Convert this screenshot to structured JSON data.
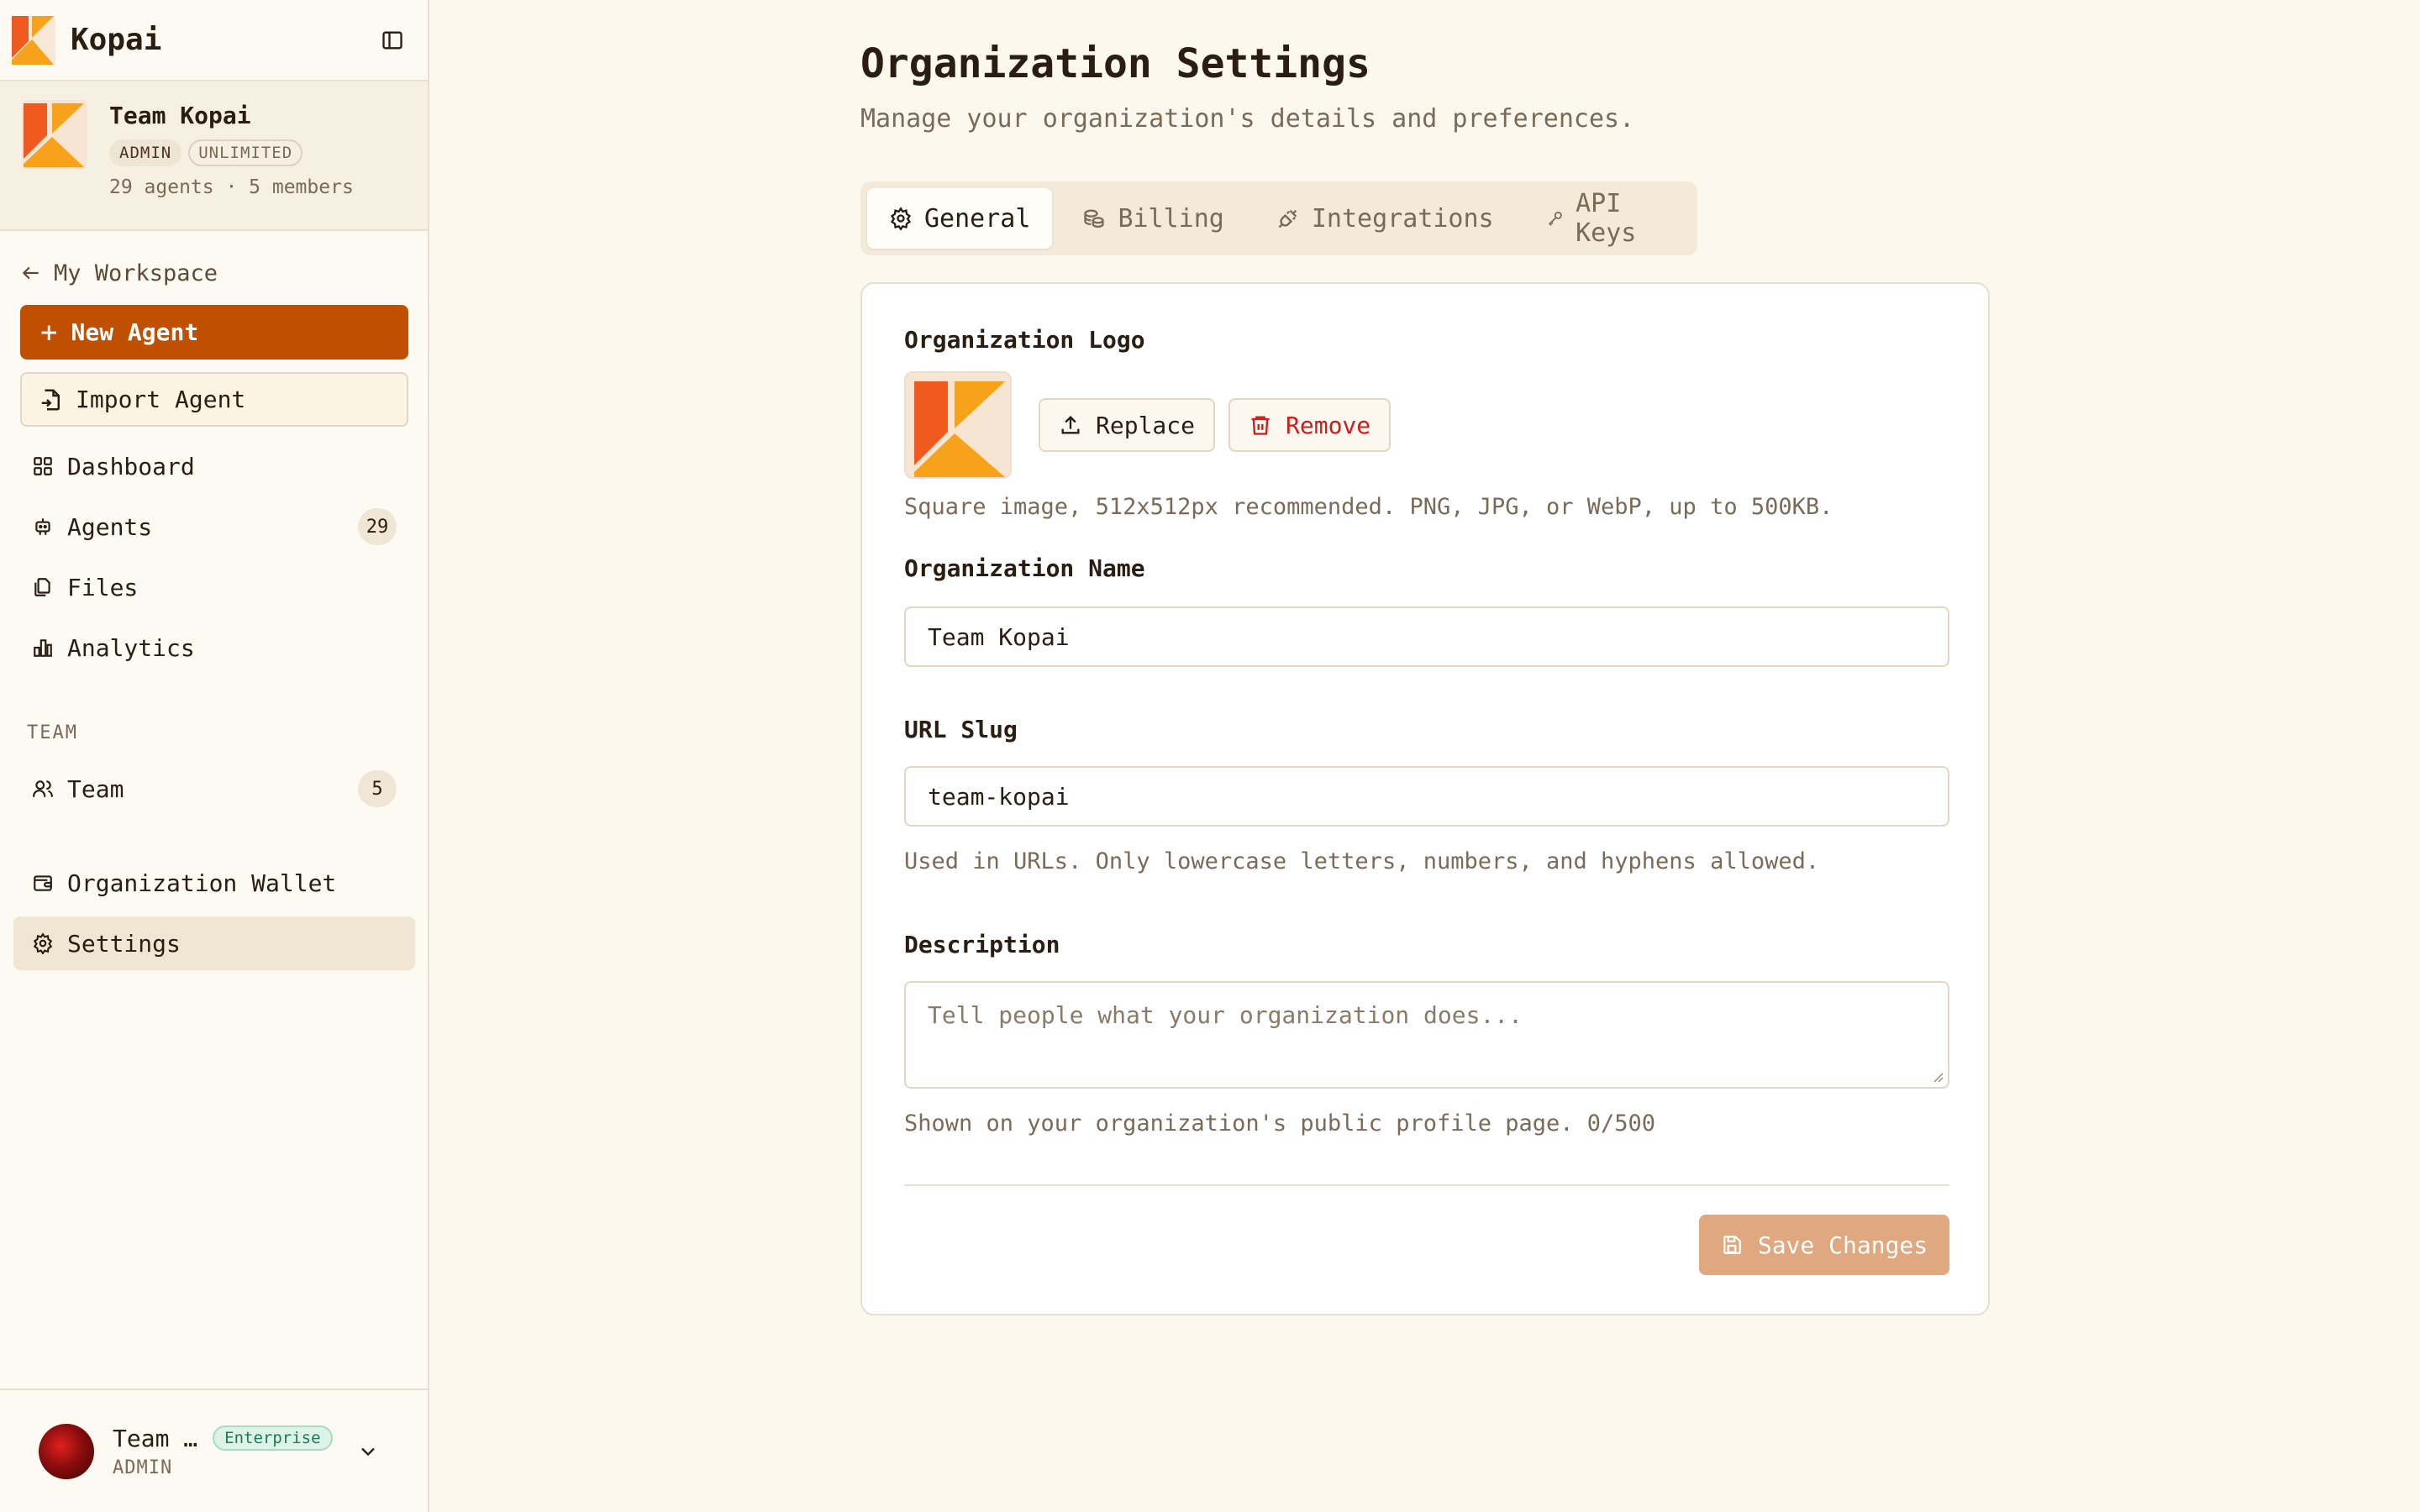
{
  "app": {
    "name": "Kopai"
  },
  "org": {
    "name": "Team Kopai",
    "badges": [
      "ADMIN",
      "UNLIMITED"
    ],
    "meta": "29 agents · 5 members"
  },
  "nav": {
    "back": "My Workspace",
    "new_agent": "New Agent",
    "import_agent": "Import Agent",
    "items": [
      {
        "label": "Dashboard"
      },
      {
        "label": "Agents",
        "count": "29"
      },
      {
        "label": "Files"
      },
      {
        "label": "Analytics"
      }
    ],
    "section_team": "TEAM",
    "team": {
      "label": "Team",
      "count": "5"
    },
    "wallet": "Organization Wallet",
    "settings": "Settings"
  },
  "user": {
    "name": "Team …",
    "plan": "Enterprise",
    "role": "ADMIN"
  },
  "page": {
    "title": "Organization Settings",
    "subtitle": "Manage your organization's details and preferences.",
    "tabs": [
      "General",
      "Billing",
      "Integrations",
      "API Keys"
    ]
  },
  "form": {
    "logo_label": "Organization Logo",
    "replace": "Replace",
    "remove": "Remove",
    "logo_hint": "Square image, 512x512px recommended. PNG, JPG, or WebP, up to 500KB.",
    "name_label": "Organization Name",
    "name_value": "Team Kopai",
    "slug_label": "URL Slug",
    "slug_value": "team-kopai",
    "slug_hint": "Used in URLs. Only lowercase letters, numbers, and hyphens allowed.",
    "desc_label": "Description",
    "desc_placeholder": "Tell people what your organization does...",
    "desc_hint": "Shown on your organization's public profile page. 0/500",
    "save": "Save Changes"
  },
  "colors": {
    "accent": "#c05000",
    "save_disabled": "#e0a87e",
    "remove": "#d11a1a",
    "background": "#fcf8ee"
  }
}
